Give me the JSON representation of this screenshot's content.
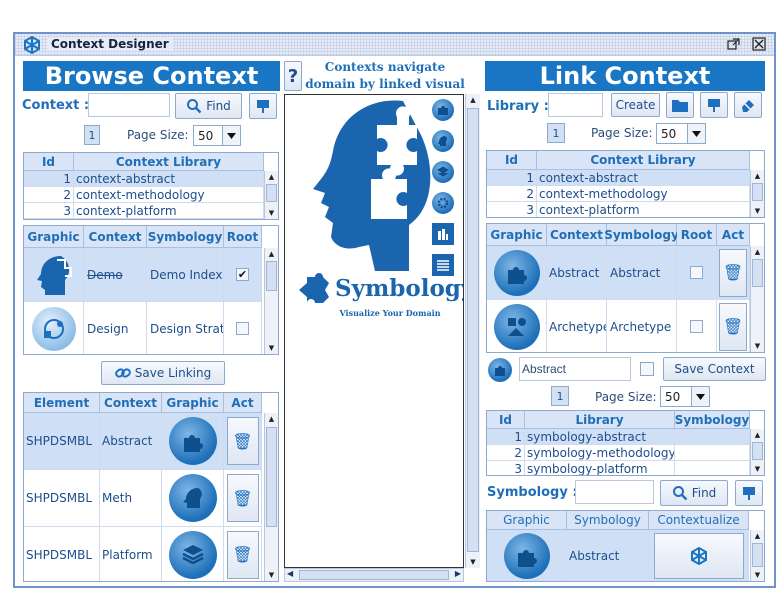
{
  "window": {
    "title": "Context Designer"
  },
  "left": {
    "banner": "Browse Context",
    "context_label": "Context :",
    "context_value": "",
    "find_label": "Find",
    "page": "1",
    "page_size_label": "Page Size:",
    "page_size": "50",
    "lib_headers": [
      "Id",
      "Context Library"
    ],
    "lib_rows": [
      {
        "id": "1",
        "name": "context-abstract"
      },
      {
        "id": "2",
        "name": "context-methodology"
      },
      {
        "id": "3",
        "name": "context-platform"
      }
    ],
    "ctx_headers": [
      "Graphic",
      "Context",
      "Symbology",
      "Root"
    ],
    "ctx_rows": [
      {
        "context": "Demo",
        "symbology": "Demo Index",
        "root": true
      },
      {
        "context": "Design",
        "symbology": "Design Strat",
        "root": false
      }
    ],
    "save_linking_label": "Save Linking",
    "el_headers": [
      "Element",
      "Context",
      "Graphic",
      "Act"
    ],
    "el_rows": [
      {
        "element": "SHPDSMBL",
        "context": "Abstract"
      },
      {
        "element": "SHPDSMBL",
        "context": "Meth"
      },
      {
        "element": "SHPDSMBL",
        "context": "Platform"
      }
    ]
  },
  "center": {
    "help_label": "?",
    "tagline": "Contexts navigate domain by linked visual elements",
    "brand": "Symbology",
    "brand_sub": "Visualize Your Domain"
  },
  "right": {
    "banner": "Link Context",
    "library_label": "Library :",
    "library_value": "",
    "create_label": "Create",
    "page": "1",
    "page_size_label": "Page Size:",
    "page_size": "50",
    "lib_headers": [
      "Id",
      "Context Library"
    ],
    "lib_rows": [
      {
        "id": "1",
        "name": "context-abstract"
      },
      {
        "id": "2",
        "name": "context-methodology"
      },
      {
        "id": "3",
        "name": "context-platform"
      }
    ],
    "ctx_headers": [
      "Graphic",
      "Context",
      "Symbology",
      "Root",
      "Act"
    ],
    "ctx_rows": [
      {
        "context": "Abstract",
        "symbology": "Abstract",
        "root": false
      },
      {
        "context": "Archetype",
        "symbology": "Archetype",
        "root": false
      }
    ],
    "edit_value": "Abstract",
    "save_context_label": "Save Context",
    "page2": "1",
    "page_size_label2": "Page Size:",
    "page_size2": "50",
    "sym_headers": [
      "Id",
      "Library",
      "Symbology"
    ],
    "sym_rows": [
      {
        "id": "1",
        "name": "symbology-abstract"
      },
      {
        "id": "2",
        "name": "symbology-methodology"
      },
      {
        "id": "3",
        "name": "symbology-platform"
      }
    ],
    "symbology_label": "Symbology :",
    "symbology_value": "",
    "find_label": "Find",
    "bottom_headers": [
      "Graphic",
      "Symbology",
      "Contextualize"
    ],
    "bottom_rows": [
      {
        "symbology": "Abstract"
      }
    ]
  },
  "colors": {
    "accent": "#1976c4",
    "header": "#d9e5f6",
    "selected": "#cfe0f6"
  }
}
